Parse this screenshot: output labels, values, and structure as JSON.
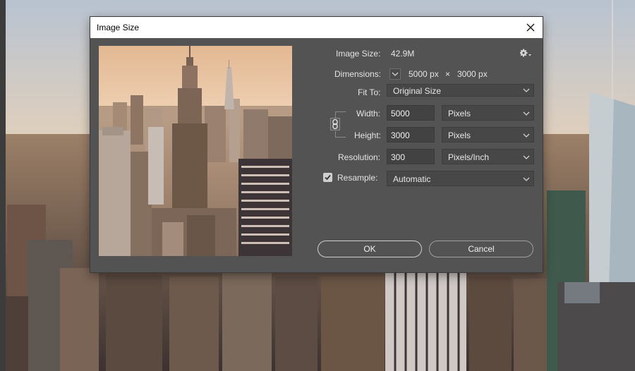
{
  "dialog": {
    "title": "Image Size",
    "image_size_label": "Image Size:",
    "image_size_value": "42.9M",
    "dimensions_label": "Dimensions:",
    "dimensions_width": "5000 px",
    "dimensions_sep": "×",
    "dimensions_height": "3000 px",
    "fit_to_label": "Fit To:",
    "fit_to_value": "Original Size",
    "width_label": "Width:",
    "width_value": "5000",
    "width_unit": "Pixels",
    "height_label": "Height:",
    "height_value": "3000",
    "height_unit": "Pixels",
    "resolution_label": "Resolution:",
    "resolution_value": "300",
    "resolution_unit": "Pixels/Inch",
    "resample_label": "Resample:",
    "resample_checked": true,
    "resample_value": "Automatic",
    "ok_label": "OK",
    "cancel_label": "Cancel"
  },
  "icons": {
    "close": "close-icon",
    "gear": "gear-icon",
    "chain": "link-chain-icon",
    "chevron": "chevron-down-icon",
    "check": "checkmark-icon"
  },
  "colors": {
    "dialog_bg": "#535353",
    "titlebar_bg": "#ffffff",
    "field_bg": "#424242",
    "text": "#e4e4e4"
  }
}
